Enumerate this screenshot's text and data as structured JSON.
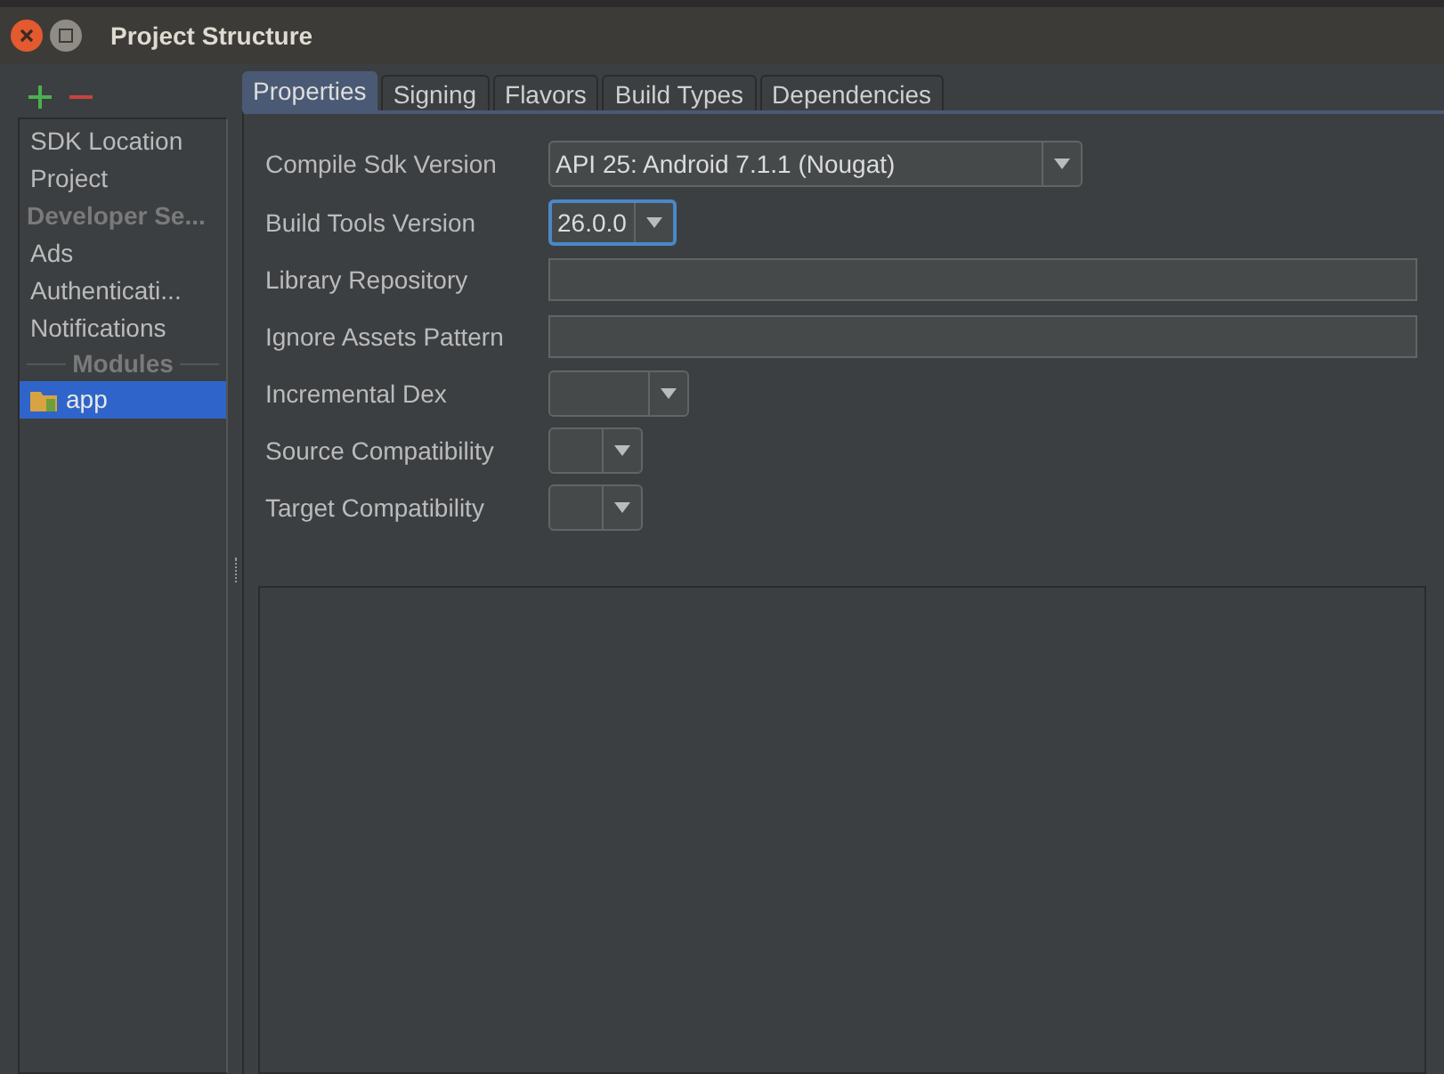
{
  "window": {
    "title": "Project Structure"
  },
  "sidebar": {
    "items": [
      {
        "kind": "item",
        "label": "SDK Location",
        "selected": false
      },
      {
        "kind": "item",
        "label": "Project",
        "selected": false
      },
      {
        "kind": "header",
        "label": "Developer Se..."
      },
      {
        "kind": "item",
        "label": "Ads",
        "selected": false
      },
      {
        "kind": "item",
        "label": "Authenticati...",
        "selected": false
      },
      {
        "kind": "item",
        "label": "Notifications",
        "selected": false
      },
      {
        "kind": "section",
        "label": "Modules"
      },
      {
        "kind": "module",
        "label": "app",
        "selected": true
      }
    ]
  },
  "tabs": [
    {
      "label": "Properties",
      "selected": true
    },
    {
      "label": "Signing",
      "selected": false
    },
    {
      "label": "Flavors",
      "selected": false
    },
    {
      "label": "Build Types",
      "selected": false
    },
    {
      "label": "Dependencies",
      "selected": false
    }
  ],
  "fields": [
    {
      "kind": "combo",
      "label": "Compile Sdk Version",
      "value": "API 25: Android 7.1.1 (Nougat)",
      "focused": false
    },
    {
      "kind": "combo",
      "label": "Build Tools Version",
      "value": "26.0.0",
      "focused": true
    },
    {
      "kind": "text",
      "label": "Library Repository"
    },
    {
      "kind": "text",
      "label": "Ignore Assets Pattern"
    },
    {
      "kind": "combo",
      "label": "Incremental Dex",
      "focused": false
    },
    {
      "kind": "combo",
      "label": "Source Compatibility",
      "focused": false
    },
    {
      "kind": "combo",
      "label": "Target Compatibility",
      "focused": false
    }
  ]
}
